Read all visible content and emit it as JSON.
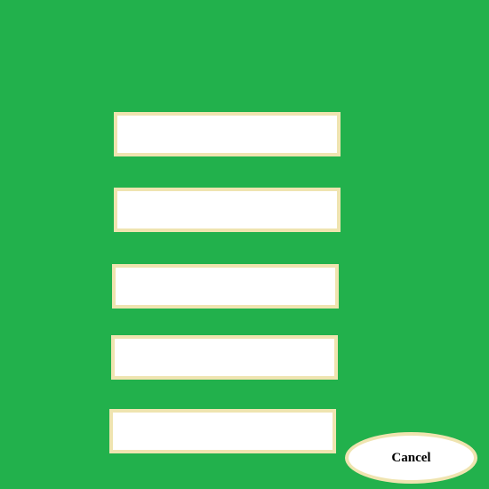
{
  "theme": {
    "background": "#22b14c",
    "field_border": "#efe4b0",
    "field_fill": "#ffffff"
  },
  "form": {
    "fields": [
      {
        "value": "",
        "placeholder": ""
      },
      {
        "value": "",
        "placeholder": ""
      },
      {
        "value": "",
        "placeholder": ""
      },
      {
        "value": "",
        "placeholder": ""
      },
      {
        "value": "",
        "placeholder": ""
      }
    ],
    "cancel_label": "Cancel"
  }
}
